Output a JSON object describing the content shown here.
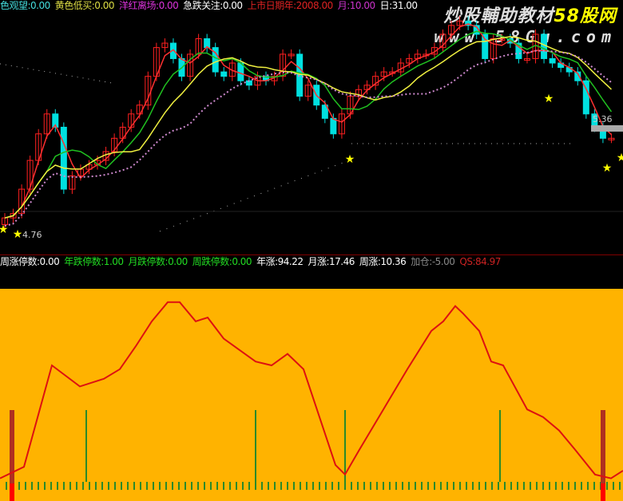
{
  "top_indicators": [
    {
      "label": "色观望",
      "value": "0.00",
      "color": "#44dddd"
    },
    {
      "label": "黄色低买",
      "value": "0.00",
      "color": "#dddd44"
    },
    {
      "label": "洋红离场",
      "value": "0.00",
      "color": "#dd33dd"
    },
    {
      "label": "急跌关注",
      "value": "0.00",
      "color": "#ffffff"
    },
    {
      "label": "上市日期年",
      "value": "2008.00",
      "color": "#dd2222"
    },
    {
      "label": "月",
      "value": "10.00",
      "color": "#cc33cc"
    },
    {
      "label": "日",
      "value": "31.00",
      "color": "#ffffff"
    }
  ],
  "mid_indicators": [
    {
      "label": "周涨停数",
      "value": "0.00",
      "color": "#ffffff"
    },
    {
      "label": "年跌停数",
      "value": "1.00",
      "color": "#22dd22"
    },
    {
      "label": "月跌停数",
      "value": "0.00",
      "color": "#22dd22"
    },
    {
      "label": "周跌停数",
      "value": "0.00",
      "color": "#22dd22"
    },
    {
      "label": "年涨",
      "value": "94.22",
      "color": "#ffffff"
    },
    {
      "label": "月涨",
      "value": "17.46",
      "color": "#ffffff"
    },
    {
      "label": "周涨",
      "value": "10.36",
      "color": "#ffffff"
    },
    {
      "label": "加仓",
      "value": "-5.00",
      "color": "#888888"
    },
    {
      "label": "QS",
      "value": "84.97",
      "color": "#cc2222"
    }
  ],
  "watermark": {
    "line1": "炒股輔助教材",
    "line1_brand": "58股网",
    "line2": "www.58Gu.com"
  },
  "price_labels": {
    "low": "4.76",
    "high": "5.36"
  },
  "colors": {
    "up": "#ff2020",
    "down": "#00e0e0",
    "ma_short": "#ff3030",
    "ma_mid": "#20c020",
    "ma_long": "#f0f040",
    "lower_bg": "#FFB300",
    "osc": "#dd1111"
  },
  "chart_data": [
    {
      "type": "candlestick",
      "title": "price",
      "closes": [
        4.84,
        4.86,
        4.97,
        5.1,
        5.22,
        5.31,
        5.25,
        4.97,
        5.03,
        5.06,
        5.08,
        5.1,
        5.14,
        5.2,
        5.25,
        5.31,
        5.35,
        5.48,
        5.61,
        5.63,
        5.56,
        5.48,
        5.58,
        5.65,
        5.61,
        5.5,
        5.48,
        5.54,
        5.46,
        5.44,
        5.48,
        5.46,
        5.48,
        5.58,
        5.58,
        5.39,
        5.44,
        5.35,
        5.29,
        5.22,
        5.31,
        5.39,
        5.42,
        5.44,
        5.48,
        5.5,
        5.5,
        5.54,
        5.56,
        5.58,
        5.58,
        5.61,
        5.67,
        5.71,
        5.73,
        5.71,
        5.67,
        5.56,
        5.65,
        5.65,
        5.63,
        5.56,
        5.56,
        5.67,
        5.56,
        5.54,
        5.52,
        5.5,
        5.46,
        5.31,
        5.25,
        5.2,
        5.2
      ],
      "ylim": [
        4.7,
        5.76
      ]
    },
    {
      "type": "line",
      "title": "oscillator",
      "ylim": [
        0,
        100
      ],
      "points": [
        [
          0,
          6
        ],
        [
          3,
          12
        ],
        [
          6.5,
          65
        ],
        [
          10,
          54
        ],
        [
          13,
          58
        ],
        [
          15,
          63
        ],
        [
          17,
          75
        ],
        [
          19,
          88
        ],
        [
          21,
          98
        ],
        [
          22.5,
          98
        ],
        [
          24.5,
          88
        ],
        [
          26,
          90
        ],
        [
          28,
          79
        ],
        [
          30,
          73
        ],
        [
          32,
          67
        ],
        [
          34,
          65
        ],
        [
          36,
          71
        ],
        [
          38,
          63
        ],
        [
          40,
          38
        ],
        [
          42,
          13
        ],
        [
          43.2,
          8
        ],
        [
          45,
          21
        ],
        [
          48,
          42
        ],
        [
          51,
          63
        ],
        [
          54,
          83
        ],
        [
          55.5,
          88
        ],
        [
          57,
          96
        ],
        [
          58,
          92
        ],
        [
          60,
          83
        ],
        [
          61.5,
          67
        ],
        [
          63,
          65
        ],
        [
          66,
          42
        ],
        [
          68,
          38
        ],
        [
          70,
          31
        ],
        [
          72,
          21
        ],
        [
          74.5,
          8
        ],
        [
          76.5,
          6
        ],
        [
          78,
          10
        ]
      ],
      "signal_bars": [
        10.8,
        32,
        43.2,
        62.6
      ],
      "strong_bars": [
        1.5,
        75.5
      ]
    }
  ]
}
